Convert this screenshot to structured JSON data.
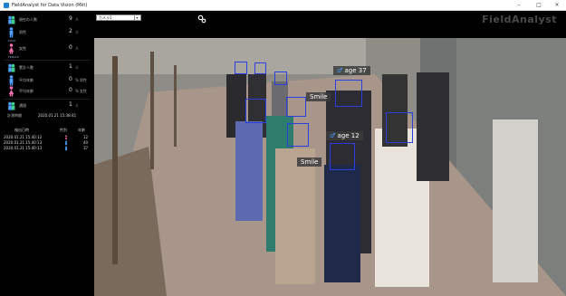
{
  "window": {
    "title": "FieldAnalyst for Data Vision (Mkt)",
    "minimize": "–",
    "maximize": "□",
    "close": "×"
  },
  "toolbar": {
    "camera_value": "カメラ1",
    "caret": "▾",
    "settings_icon": "gear-icon",
    "brand": "FieldAnalyst"
  },
  "stats": [
    {
      "icon": "person-pair-icon",
      "color": "#4da3ff",
      "label": "現在の人数",
      "value": "9",
      "unit": "人",
      "extra": ""
    },
    {
      "icon": "male-icon",
      "color": "#4da3ff",
      "label": "男性",
      "value": "2",
      "unit": "人",
      "extra": ""
    },
    {
      "icon": "female-icon",
      "color": "#f06fb0",
      "label": "女性",
      "value": "0",
      "unit": "人",
      "extra": ""
    },
    {
      "icon": "person-pair-icon",
      "color": "#4da3ff",
      "label": "累計人数",
      "value": "1",
      "unit": "人",
      "extra": ""
    },
    {
      "icon": "male-icon",
      "color": "#4da3ff",
      "label": "平均年齢",
      "value": "0",
      "unit": "%",
      "extra": "男性"
    },
    {
      "icon": "female-icon",
      "color": "#f06fb0",
      "label": "平均年齢",
      "value": "0",
      "unit": "%",
      "extra": "女性"
    },
    {
      "icon": "person-pair-icon",
      "color": "#4da3ff",
      "label": "通過",
      "value": "1",
      "unit": "人",
      "extra": ""
    }
  ],
  "captions": {
    "male": "MALE",
    "female": "FEMALE"
  },
  "start_time": {
    "label": "計測時間",
    "value": "2020.01.21 15:38:41"
  },
  "log": {
    "headers": [
      "検出日時",
      "性別",
      "年齢"
    ],
    "rows": [
      {
        "time": "2020.01.21 15:40:12",
        "gender_icon": "female-icon",
        "age": "12"
      },
      {
        "time": "2020.01.21 15:40:13",
        "gender_icon": "male-icon",
        "age": "40"
      },
      {
        "time": "2020.01.21 15:40:13",
        "gender_icon": "male-icon",
        "age": "37"
      }
    ]
  },
  "overlays": [
    {
      "kind": "age",
      "text": "age 37"
    },
    {
      "kind": "smile",
      "text": "Smile"
    },
    {
      "kind": "age",
      "text": "age 12"
    },
    {
      "kind": "smile",
      "text": "Smile"
    }
  ],
  "colors": {
    "face_box": "#2b3fe0",
    "male": "#4da3ff",
    "female": "#f06fb0",
    "panel_bg": "#000000"
  }
}
